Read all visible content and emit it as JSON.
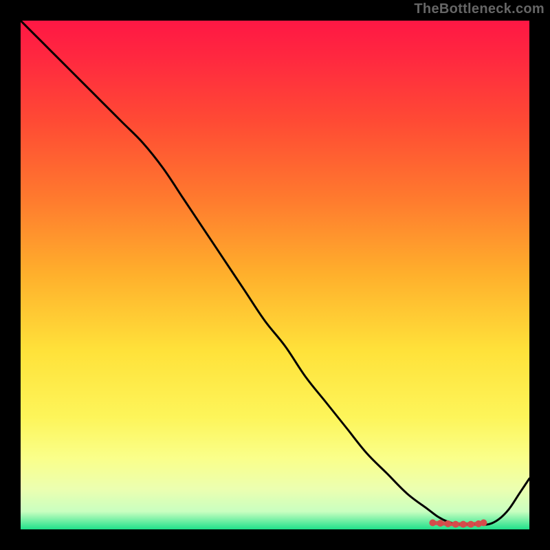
{
  "watermark": "TheBottleneck.com",
  "chart_data": {
    "type": "line",
    "title": "",
    "xlabel": "",
    "ylabel": "",
    "xlim": [
      0,
      100
    ],
    "ylim": [
      0,
      100
    ],
    "grid": false,
    "axes_visible": false,
    "background": {
      "gradient_stops": [
        {
          "pos": 0.0,
          "color": "#ff1744"
        },
        {
          "pos": 0.08,
          "color": "#ff2a3f"
        },
        {
          "pos": 0.2,
          "color": "#ff4b34"
        },
        {
          "pos": 0.35,
          "color": "#ff7a2e"
        },
        {
          "pos": 0.5,
          "color": "#ffb02c"
        },
        {
          "pos": 0.65,
          "color": "#ffe23a"
        },
        {
          "pos": 0.78,
          "color": "#fdf55a"
        },
        {
          "pos": 0.86,
          "color": "#faff8a"
        },
        {
          "pos": 0.92,
          "color": "#ecffb0"
        },
        {
          "pos": 0.965,
          "color": "#c9ffc0"
        },
        {
          "pos": 1.0,
          "color": "#1fe08a"
        }
      ]
    },
    "series": [
      {
        "name": "bottleneck-curve",
        "color": "#000000",
        "x": [
          0,
          4,
          8,
          12,
          16,
          20,
          24,
          28,
          32,
          36,
          40,
          44,
          48,
          52,
          56,
          60,
          64,
          68,
          72,
          76,
          80,
          82,
          84,
          86,
          88,
          90,
          92,
          94,
          96,
          98,
          100
        ],
        "values": [
          100,
          96,
          92,
          88,
          84,
          80,
          76,
          71,
          65,
          59,
          53,
          47,
          41,
          36,
          30,
          25,
          20,
          15,
          11,
          7,
          4,
          2.5,
          1.5,
          1,
          1,
          1,
          1,
          2,
          4,
          7,
          10
        ]
      }
    ],
    "markers": {
      "name": "flat-bottom-markers",
      "color": "#d64b4b",
      "x": [
        81,
        82.5,
        84,
        85.5,
        87,
        88.5,
        90,
        91
      ],
      "values": [
        1.3,
        1.2,
        1.1,
        1.0,
        1.0,
        1.0,
        1.1,
        1.3
      ]
    }
  }
}
